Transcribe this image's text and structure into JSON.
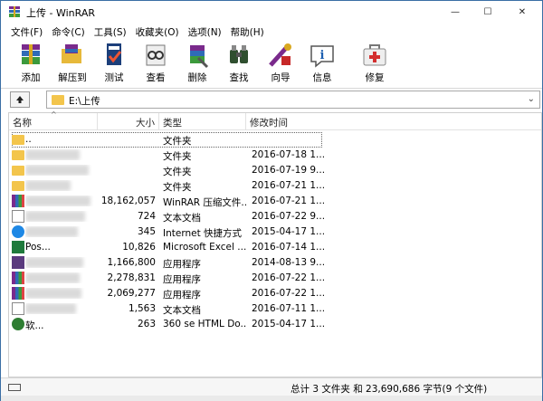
{
  "window": {
    "title": "上传 - WinRAR",
    "minimize": "—",
    "maximize": "☐",
    "close": "✕"
  },
  "menu": [
    "文件(F)",
    "命令(C)",
    "工具(S)",
    "收藏夹(O)",
    "选项(N)",
    "帮助(H)"
  ],
  "toolbar": [
    {
      "label": "添加",
      "icon": "add-archive-icon"
    },
    {
      "label": "解压到",
      "icon": "extract-to-icon"
    },
    {
      "label": "测试",
      "icon": "test-icon"
    },
    {
      "label": "查看",
      "icon": "view-icon"
    },
    {
      "label": "删除",
      "icon": "delete-icon"
    },
    {
      "label": "查找",
      "icon": "find-icon"
    },
    {
      "label": "向导",
      "icon": "wizard-icon"
    },
    {
      "label": "信息",
      "icon": "info-icon"
    },
    {
      "label": "修复",
      "icon": "repair-icon"
    }
  ],
  "address": {
    "path": "E:\\上传",
    "dropdown": "⌄"
  },
  "columns": {
    "name": "名称",
    "size": "大小",
    "type": "类型",
    "mtime": "修改时间",
    "sort_indicator": "^"
  },
  "files": [
    {
      "name": "..",
      "size": "",
      "type": "文件夹",
      "mtime": "",
      "icon": "folder-icon"
    },
    {
      "name": "",
      "size": "",
      "type": "文件夹",
      "mtime": "2016-07-18 1...",
      "icon": "folder-icon"
    },
    {
      "name": "",
      "size": "",
      "type": "文件夹",
      "mtime": "2016-07-19 9...",
      "icon": "folder-icon"
    },
    {
      "name": "",
      "size": "",
      "type": "文件夹",
      "mtime": "2016-07-21 1...",
      "icon": "folder-icon"
    },
    {
      "name": "",
      "size": "18,162,057",
      "type": "WinRAR 压缩文件...",
      "mtime": "2016-07-21 1...",
      "icon": "rar-archive-icon"
    },
    {
      "name": "",
      "size": "724",
      "type": "文本文档",
      "mtime": "2016-07-22 9...",
      "icon": "text-document-icon"
    },
    {
      "name": "",
      "size": "345",
      "type": "Internet 快捷方式",
      "mtime": "2015-04-17 1...",
      "icon": "internet-shortcut-icon"
    },
    {
      "name": "Pos...",
      "size": "10,826",
      "type": "Microsoft Excel ...",
      "mtime": "2016-07-14 1...",
      "icon": "excel-icon"
    },
    {
      "name": "",
      "size": "1,166,800",
      "type": "应用程序",
      "mtime": "2014-08-13 9...",
      "icon": "application-icon"
    },
    {
      "name": "",
      "size": "2,278,831",
      "type": "应用程序",
      "mtime": "2016-07-22 1...",
      "icon": "application-icon"
    },
    {
      "name": "",
      "size": "2,069,277",
      "type": "应用程序",
      "mtime": "2016-07-22 1...",
      "icon": "application-icon"
    },
    {
      "name": "",
      "size": "1,563",
      "type": "文本文档",
      "mtime": "2016-07-11 1...",
      "icon": "text-document-icon"
    },
    {
      "name": "软...",
      "size": "263",
      "type": "360 se HTML Do...",
      "mtime": "2015-04-17 1...",
      "icon": "html-document-icon"
    }
  ],
  "status": {
    "text": "总计 3 文件夹 和 23,690,686 字节(9 个文件)"
  }
}
